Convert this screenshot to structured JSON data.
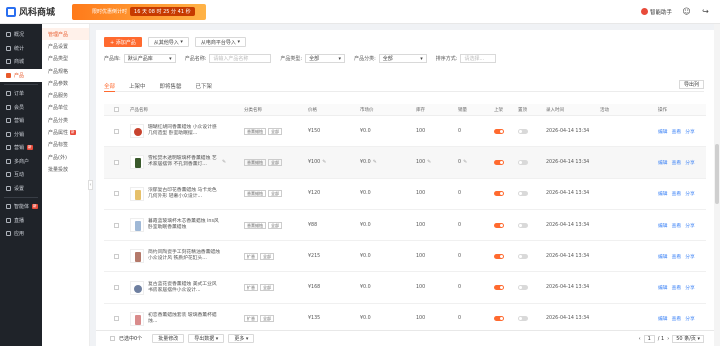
{
  "app": {
    "name": "风科商城"
  },
  "banner": {
    "text": "限时优惠倒计时",
    "countdown": "16 天 08 时 25 分 41 秒"
  },
  "header": {
    "assistant": "智能助手"
  },
  "nav1": [
    {
      "label": "概况",
      "active": false
    },
    {
      "label": "统计",
      "active": false
    },
    {
      "label": "商城",
      "active": false
    },
    {
      "label": "产品",
      "active": true
    },
    {
      "label": "订单",
      "active": false
    },
    {
      "label": "会员",
      "active": false
    },
    {
      "label": "营销",
      "active": false
    },
    {
      "label": "分销",
      "active": false
    },
    {
      "label": "营销",
      "active": false,
      "tag": "新"
    },
    {
      "label": "多商户",
      "active": false
    },
    {
      "label": "互动",
      "active": false
    },
    {
      "label": "设置",
      "active": false
    },
    {
      "label": "智能体",
      "active": false,
      "tag": "新"
    },
    {
      "label": "直播",
      "active": false
    },
    {
      "label": "应用",
      "active": false
    }
  ],
  "nav2": [
    {
      "label": "管理产品",
      "active": true
    },
    {
      "label": "产品设置"
    },
    {
      "label": "产品类型"
    },
    {
      "label": "产品规格"
    },
    {
      "label": "产品参数"
    },
    {
      "label": "产品服务"
    },
    {
      "label": "产品单位"
    },
    {
      "label": "产品分类"
    },
    {
      "label": "产品属性",
      "tag": "新"
    },
    {
      "label": "产品标签"
    },
    {
      "label": "产品(外)"
    },
    {
      "label": "批量投放"
    }
  ],
  "toolbar": {
    "add": "+ 添加产品",
    "import1": "从其他导入",
    "import2": "从电商平台导入"
  },
  "filters": {
    "library_label": "产品库:",
    "library_value": "默认产品库",
    "name_label": "产品名称:",
    "name_placeholder": "请输入产品名称",
    "type_label": "产品类型:",
    "type_value": "全部",
    "cat_label": "产品分类:",
    "cat_value": "全部",
    "sort_label": "排序方式:",
    "sort_placeholder": "请选择..."
  },
  "tabs": [
    "全部",
    "上架中",
    "即将售罄",
    "已下架"
  ],
  "export": "导出列",
  "columns": {
    "name": "产品名称",
    "category": "分类名称",
    "price": "价格",
    "market": "市场价",
    "stock": "库存",
    "sales": "销量",
    "onsale": "上架",
    "hot": "置顶",
    "time": "录入时间",
    "activity": "活动",
    "ops": "操作"
  },
  "ops": {
    "edit": "编辑",
    "view": "查看",
    "share": "分享"
  },
  "rows": [
    {
      "name": "珊瑚红胡同香薰蜡烛 小众设计感几何造型 卧室助眠摆...",
      "cats": [
        "香薰蜡烛",
        "全部"
      ],
      "price": "¥150",
      "market": "¥0.0",
      "stock": "100",
      "sales": "0",
      "on": true,
      "hot": false,
      "time": "2026-04-14 13:34",
      "color": "#c8432e",
      "round": true
    },
    {
      "name": "雪松焚木透明玻璃杯香薰蜡烛 艺术家居摆饰 不孔洞香薰灯...",
      "cats": [
        "香薰蜡烛",
        "全部"
      ],
      "price": "¥100",
      "market": "¥0.0",
      "stock": "100",
      "sales": "0",
      "on": true,
      "hot": false,
      "time": "2026-04-14 13:34",
      "color": "#3a5a2c",
      "round": false,
      "edit": true
    },
    {
      "name": "浓郁复古印花香薰蜡烛 马卡龙色几何外形 轻奢小众设计...",
      "cats": [
        "香薰蜡烛",
        "全部"
      ],
      "price": "¥120",
      "market": "¥0.0",
      "stock": "100",
      "sales": "0",
      "on": true,
      "hot": false,
      "time": "2026-04-14 13:34",
      "color": "#e6c06a",
      "round": false
    },
    {
      "name": "暮霞蓝玻璃杯木芯香薰蜡烛 ins风 卧室助眠香薰蜡烛",
      "cats": [
        "香薰蜡烛",
        "全部"
      ],
      "price": "¥88",
      "market": "¥0.0",
      "stock": "100",
      "sales": "0",
      "on": true,
      "hot": false,
      "time": "2026-04-14 13:34",
      "color": "#9fb8d6",
      "round": false
    },
    {
      "name": "简约风陶瓷手工刻花精油香薰蜡烛 小众设计风 铁质炉花缸头...",
      "cats": [
        "扩香",
        "全部"
      ],
      "price": "¥215",
      "market": "¥0.0",
      "stock": "100",
      "sales": "0",
      "on": true,
      "hot": false,
      "time": "2026-04-14 13:34",
      "color": "#b4796a",
      "round": false
    },
    {
      "name": "复古蓝花瓷香薰蜡烛 美式工业风 书房家居摆件小众设计...",
      "cats": [
        "扩香",
        "全部"
      ],
      "price": "¥168",
      "market": "¥0.0",
      "stock": "100",
      "sales": "0",
      "on": true,
      "hot": false,
      "time": "2026-04-14 13:34",
      "color": "#6e7fa0",
      "round": true
    },
    {
      "name": "初恋香薰蜡烛套装 玻璃香薰杯蜡烛...",
      "cats": [
        "扩香",
        "全部"
      ],
      "price": "¥135",
      "market": "¥0.0",
      "stock": "100",
      "sales": "0",
      "on": true,
      "hot": false,
      "time": "2026-04-14 13:34",
      "color": "#d98b8b",
      "round": false
    }
  ],
  "footer": {
    "selected": "已选中0个",
    "batch_edit": "批量修改",
    "export": "导出数据",
    "more": "更多",
    "page": "1",
    "total": "/ 1",
    "per_page": "50 条/页"
  }
}
